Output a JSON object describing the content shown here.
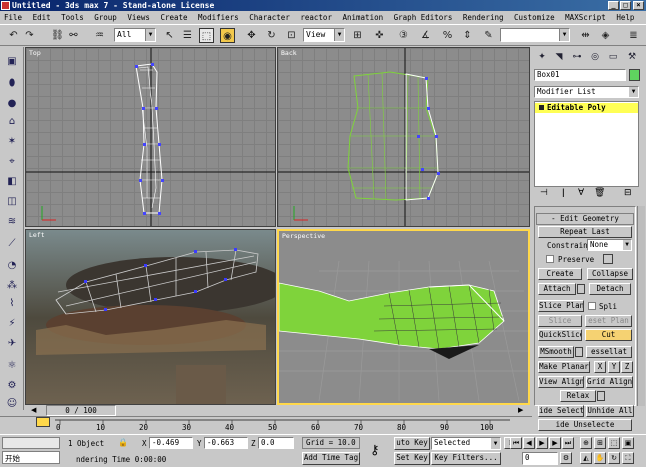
{
  "window": {
    "title": "Untitled - 3ds max 7 - Stand-alone License",
    "min": "_",
    "max": "□",
    "close": "×"
  },
  "menu": [
    "File",
    "Edit",
    "Tools",
    "Group",
    "Views",
    "Create",
    "Modifiers",
    "Character",
    "reactor",
    "Animation",
    "Graph Editors",
    "Rendering",
    "Customize",
    "MAXScript",
    "Help"
  ],
  "toolbar": {
    "filter": "All",
    "refcoord": "View"
  },
  "viewports": {
    "top": "Top",
    "front": "Back",
    "left": "Left",
    "perspective": "Perspective"
  },
  "panel": {
    "object_name": "Box01",
    "object_color": "#5fd35f",
    "modifier_list": "Modifier List",
    "stack_item": "Editable Poly",
    "rollout": "Edit Geometry",
    "repeat_last": "Repeat Last",
    "constraints_label": "Constraints:",
    "constraints_value": "None",
    "preserve": "Preserve",
    "create": "Create",
    "collapse": "Collapse",
    "attach": "Attach",
    "detach": "Detach",
    "slice_plane": "Slice Plane",
    "split": "Spli",
    "slice": "Slice",
    "reset_plane": "eset Plan",
    "quickslice": "QuickSlice",
    "cut": "Cut",
    "msmooth": "MSmooth",
    "tessellate": "essellat",
    "make_planar": "Make Planar",
    "x": "X",
    "y": "Y",
    "z": "Z",
    "view_align": "View Align",
    "grid_align": "Grid Align",
    "relax": "Relax",
    "hide_selected": "ide Selecte",
    "unhide_all": "Unhide All",
    "hide_unselected": "ide Unselecte"
  },
  "timeline": {
    "frame": "0 / 100",
    "ticks": [
      "0",
      "10",
      "20",
      "30",
      "40",
      "50",
      "60",
      "70",
      "80",
      "90",
      "100"
    ]
  },
  "status": {
    "selection": "1 Object",
    "x_label": "X",
    "x_value": "-0.469",
    "y_label": "Y",
    "y_value": "-0.663",
    "z_label": "Z",
    "z_value": "0.0",
    "grid": "Grid = 10.0",
    "auto_key": "uto Key",
    "selected": "Selected",
    "set_key": "Set Key",
    "key_filters": "Key Filters...",
    "prompt": "ndering Time  0:00:00",
    "add_time_tag": "Add Time Tag",
    "start_label": "开始",
    "frame_field": "0"
  },
  "colors": {
    "accent": "#0a246a",
    "poly_green": "#7fd33b",
    "active_border": "#ffd84a"
  }
}
